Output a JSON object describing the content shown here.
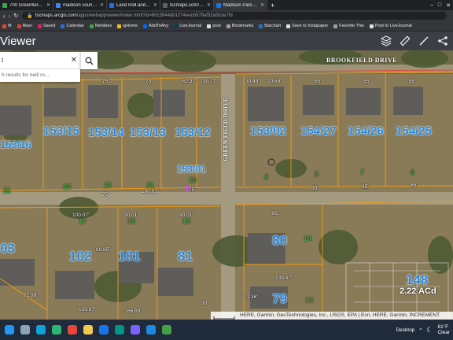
{
  "browser": {
    "tabs": [
      {
        "label": "700 Greenfield Dr - Google Maps",
        "color": "#34a853",
        "active": false
      },
      {
        "label": "madison county ms tax assessor",
        "color": "#4285f4",
        "active": false
      },
      {
        "label": "Land Roll and Maps | Madison Co",
        "color": "#1a73e8",
        "active": false
      },
      {
        "label": "tscmaps.com/cnty/madison-ms/",
        "color": "#5f6368",
        "active": false
      },
      {
        "label": "Madison Parcel Viewer",
        "color": "#1a73e8",
        "active": true
      }
    ],
    "url_host": "tscmaps.arcgis.com",
    "url_path": "/apps/webappviewer/index.html?id=60c3944db1274eecb578af32a5b2e7fd",
    "bookmarks": [
      {
        "label": "M",
        "color": "#ea4335"
      },
      {
        "label": "Atavi",
        "color": "#e53935"
      },
      {
        "label": "Saved",
        "color": "#e91e63"
      },
      {
        "label": "Calendar",
        "color": "#1a73e8"
      },
      {
        "label": "Netvibes",
        "color": "#43a047"
      },
      {
        "label": "igHome",
        "color": "#fbbc05"
      },
      {
        "label": "AddToAny",
        "color": "#0166ff"
      },
      {
        "label": "LiveJournal",
        "color": "#004359"
      },
      {
        "label": "post",
        "color": "#e0e0e0"
      },
      {
        "label": "Bookmarks",
        "color": "#9e9e9e"
      },
      {
        "label": "Barchart",
        "color": "#1976d2"
      },
      {
        "label": "Save to Instapaper",
        "color": "#e0e0e0"
      },
      {
        "label": "Favorite This",
        "color": "#9e9e9e"
      },
      {
        "label": "Post to LiveJournal",
        "color": "#e0e0e0"
      }
    ]
  },
  "app": {
    "title": "Viewer",
    "header_icons": [
      "layers-icon",
      "measure-icon",
      "ruler-icon",
      "share-icon"
    ]
  },
  "search": {
    "value": "t",
    "hint": "h results for neill ro..."
  },
  "map": {
    "streets": {
      "top": "BROOKFIELD DRIVE",
      "vertical": "GREEN FIELD DRIVE"
    },
    "parcels_top": [
      {
        "id": "153/16",
        "size": 13
      },
      {
        "id": "153/15",
        "size": 15
      },
      {
        "id": "153/14",
        "size": 15
      },
      {
        "id": "153/13",
        "size": 15
      },
      {
        "id": "153/12",
        "size": 15
      },
      {
        "id": "153/01",
        "size": 12
      },
      {
        "id": "153/02",
        "size": 15
      },
      {
        "id": "154/27",
        "size": 15
      },
      {
        "id": "154/26",
        "size": 15
      },
      {
        "id": "154/25",
        "size": 15
      }
    ],
    "parcels_bottom": [
      {
        "id": "03",
        "size": 17
      },
      {
        "id": "102",
        "size": 17
      },
      {
        "id": "101",
        "size": 17
      },
      {
        "id": "81",
        "size": 17
      },
      {
        "id": "80",
        "size": 17
      },
      {
        "id": "79",
        "size": 17
      },
      {
        "id": "148",
        "size": 17
      }
    ],
    "acreage": "2.22 ACd",
    "lots": [
      "11",
      "13",
      "12",
      "11",
      "10",
      "9",
      "8",
      "7",
      "6",
      "17",
      "16",
      "15",
      "14",
      "13"
    ],
    "dims": [
      "60.26'",
      "75'",
      "75'",
      "62.37'",
      "30.77'",
      "30.49'",
      "70.68'",
      "85'",
      "85'",
      "85'",
      "100.07'",
      "90.01'",
      "90.01'",
      "100.01'",
      "75'",
      "75'",
      "80'",
      "85'",
      "85'",
      "85'",
      "139.47'",
      "139.87'",
      "72.98'",
      "66.89'",
      "90'",
      "71.36'",
      "89.85'"
    ],
    "attribution": "HERE, Garmin, GeoTechnologies, Inc., USGS, EPA | Esri, HERE, Garmin, INCREMENT"
  },
  "taskbar": {
    "weather_temp": "61°F",
    "weather_desc": "Clear",
    "desktop_label": "Desktop",
    "apps": [
      {
        "name": "start-icon",
        "color": "#2196f3"
      },
      {
        "name": "search-icon",
        "color": "#8fa3b8"
      },
      {
        "name": "edge-icon",
        "color": "#0fa3d9"
      },
      {
        "name": "edge-icon-2",
        "color": "#2bb673"
      },
      {
        "name": "chrome-icon",
        "color": "#e8453c"
      },
      {
        "name": "folder-icon",
        "color": "#f2c94c"
      },
      {
        "name": "mail-icon",
        "color": "#1a73e8"
      },
      {
        "name": "edge-dev-icon",
        "color": "#009688"
      },
      {
        "name": "app-icon",
        "color": "#7b61ff"
      },
      {
        "name": "app-icon-2",
        "color": "#1e88e5"
      },
      {
        "name": "app-icon-3",
        "color": "#43a047"
      }
    ]
  }
}
